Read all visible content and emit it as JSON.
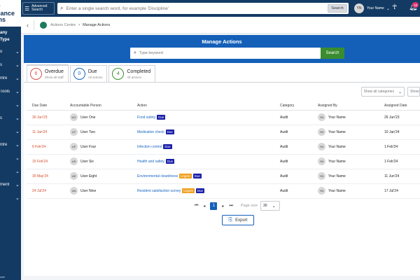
{
  "sidebar": {
    "logo_lines": [
      "ity",
      "pliance",
      "ems"
    ],
    "subtitle_lines": [
      "any",
      "Type"
    ],
    "items": [
      "o",
      "s",
      "ntre",
      "Tools",
      "",
      "s",
      "",
      "ntre",
      "",
      "",
      "ment",
      ""
    ],
    "footer": "ance"
  },
  "topbar": {
    "advanced_search_label": "Advanced Search",
    "search_placeholder": "Enter a single search word, for example 'Discipline'",
    "search_button": "Search",
    "user_initials": "YN",
    "user_name": "Your Name",
    "notification_count": "18"
  },
  "breadcrumb": {
    "parent": "Actions Centre",
    "current": "Manage Actions"
  },
  "hero": {
    "title": "Manage Actions",
    "keyword_placeholder": "Type keyword",
    "search_button": "Search"
  },
  "tabs": [
    {
      "count": "6",
      "label": "Overdue",
      "sub": "Show all staff",
      "color": "#d9534f"
    },
    {
      "count": "0",
      "label": "Due",
      "sub": "All actions",
      "color": "#1565c0"
    },
    {
      "count": "4",
      "label": "Completed",
      "sub": "All actions",
      "color": "#3a8c2f"
    }
  ],
  "filters": {
    "category": "Show all categories",
    "show": "Show"
  },
  "table": {
    "headers": [
      "Due Date",
      "Accountable Person",
      "Action",
      "Category",
      "Assigned By",
      "Assigned Date"
    ],
    "rows": [
      {
        "due": "30 Jun'23",
        "initials": "UO",
        "person": "User One",
        "action": "Food safety",
        "tags": [
          {
            "text": "Due",
            "color": "#1a1fa8"
          }
        ],
        "category": "Audit",
        "by_initials": "YN",
        "by": "Your Name",
        "assigned": "26 Jun'23"
      },
      {
        "due": "11 Jan'24",
        "initials": "UT",
        "person": "User Two",
        "action": "Medication check",
        "tags": [
          {
            "text": "Due",
            "color": "#1a1fa8"
          }
        ],
        "category": "Audit",
        "by_initials": "YN",
        "by": "Your Name",
        "assigned": "10 Jan'24"
      },
      {
        "due": "6 Feb'24",
        "initials": "UF",
        "person": "User Four",
        "action": "Infection control",
        "tags": [
          {
            "text": "Due",
            "color": "#1a1fa8"
          }
        ],
        "category": "Audit",
        "by_initials": "YN",
        "by": "Your Name",
        "assigned": "1 Feb'24"
      },
      {
        "due": "15 Feb'24",
        "initials": "US",
        "person": "User Six",
        "action": "Health and safety",
        "tags": [
          {
            "text": "Due",
            "color": "#1a1fa8"
          }
        ],
        "category": "Audit",
        "by_initials": "YN",
        "by": "Your Name",
        "assigned": "1 Feb'24"
      },
      {
        "due": "30 May'24",
        "initials": "UE",
        "person": "User Eight",
        "action": "Environmental cleanliness",
        "tags": [
          {
            "text": "Urgent",
            "color": "#f0a020"
          },
          {
            "text": "Due",
            "color": "#1a1fa8"
          }
        ],
        "category": "Audit",
        "by_initials": "YN",
        "by": "Your Name",
        "assigned": "11 Jun'24"
      },
      {
        "due": "24 Jul'24",
        "initials": "UN",
        "person": "User Nine",
        "action": "Resident satisfaction survey",
        "tags": [
          {
            "text": "Urgent",
            "color": "#f0a020"
          },
          {
            "text": "Due",
            "color": "#1a1fa8"
          }
        ],
        "category": "Audit",
        "by_initials": "YN",
        "by": "Your Name",
        "assigned": "17 Jul'24"
      }
    ]
  },
  "pager": {
    "current_page": "1",
    "page_size_label": "Page size",
    "page_size": "30"
  },
  "export_label": "Export"
}
